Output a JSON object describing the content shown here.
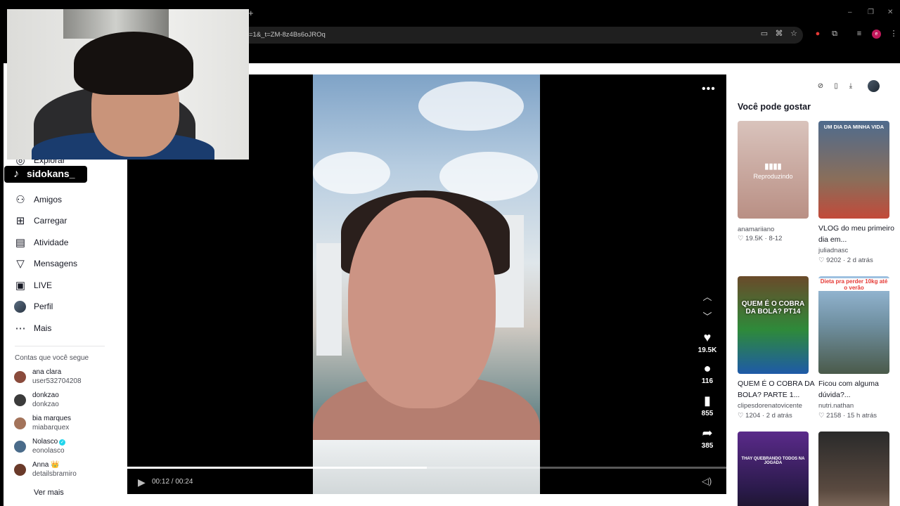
{
  "browser": {
    "new_tab_glyph": "+",
    "url_fragment": "=1&_t=ZM-8z4Bs6oJROq",
    "profile_initial": "e",
    "window_controls": [
      "–",
      "❐",
      "✕"
    ]
  },
  "streamer": {
    "name": "sidokans_"
  },
  "sidebar": {
    "partial_item": "Explorar",
    "items": [
      {
        "label": "Amigos",
        "icon": "friends-icon"
      },
      {
        "label": "Carregar",
        "icon": "upload-icon"
      },
      {
        "label": "Atividade",
        "icon": "activity-icon"
      },
      {
        "label": "Mensagens",
        "icon": "messages-icon"
      },
      {
        "label": "LIVE",
        "icon": "live-icon"
      },
      {
        "label": "Perfil",
        "icon": "profile-avatar"
      },
      {
        "label": "Mais",
        "icon": "more-icon"
      }
    ],
    "following_title": "Contas que você segue",
    "accounts": [
      {
        "display": "ana clara",
        "handle": "user532704208",
        "color": "#8a4b3c"
      },
      {
        "display": "donkzao",
        "handle": "donkzao",
        "color": "#3b3b3b"
      },
      {
        "display": "bia marques",
        "handle": "miabarquex",
        "color": "#a3735a"
      },
      {
        "display": "Nolasco",
        "handle": "eonolasco",
        "color": "#4a6b8a"
      },
      {
        "display": "Anna 👑",
        "handle": "detailsbramiro",
        "color": "#6a3a2a"
      }
    ],
    "see_more": "Ver mais"
  },
  "player": {
    "likes": "19.5K",
    "comments": "116",
    "saves": "855",
    "shares": "385",
    "time": "00:12 / 00:24",
    "progress": 0.5
  },
  "right": {
    "section_title": "Você pode gostar",
    "cards": [
      {
        "title": "",
        "author": "anamariiano",
        "likes": "19.5K",
        "date": "8-12",
        "overlay": "Reproduzindo",
        "bg": "linear-gradient(180deg,#d9c3bc,#b98f84)"
      },
      {
        "title": "VLOG do meu primeiro dia em...",
        "author": "juliadnasc",
        "likes": "9202",
        "date": "2 d atrás",
        "overlay": "UM DIA DA MINHA VIDA",
        "bg": "linear-gradient(180deg,#4f6b8d,#8a6e5a 60%,#c24a3a)"
      },
      {
        "title": "QUEM É O COBRA DA BOLA? PARTE 1...",
        "author": "clipesdorenatovicente",
        "likes": "1204",
        "date": "2 d atrás",
        "overlay": "QUEM É O COBRA DA BOLA? PT14",
        "bg": "linear-gradient(180deg,#6a4a2a,#2e8a3a 55%,#1e5aa8)"
      },
      {
        "title": "Ficou com alguma dúvida?...",
        "author": "nutri.nathan",
        "likes": "2158",
        "date": "15 h atrás",
        "overlay": "Dieta pra perder 10kg até o verão",
        "bg": "linear-gradient(180deg,#9fc2e2,#6f8fa0 50%,#4a5a4a)"
      },
      {
        "title": "",
        "author": "",
        "likes": "",
        "date": "",
        "overlay": "THAY QUEBRANDO TODOS NA JOGADA",
        "bg": "linear-gradient(180deg,#5a2a8a,#2a1a4a 60%,#111)"
      },
      {
        "title": "",
        "author": "",
        "likes": "",
        "date": "",
        "overlay": "",
        "bg": "linear-gradient(180deg,#2a2a2a,#5a4a40 60%,#a88e7a)"
      }
    ]
  }
}
